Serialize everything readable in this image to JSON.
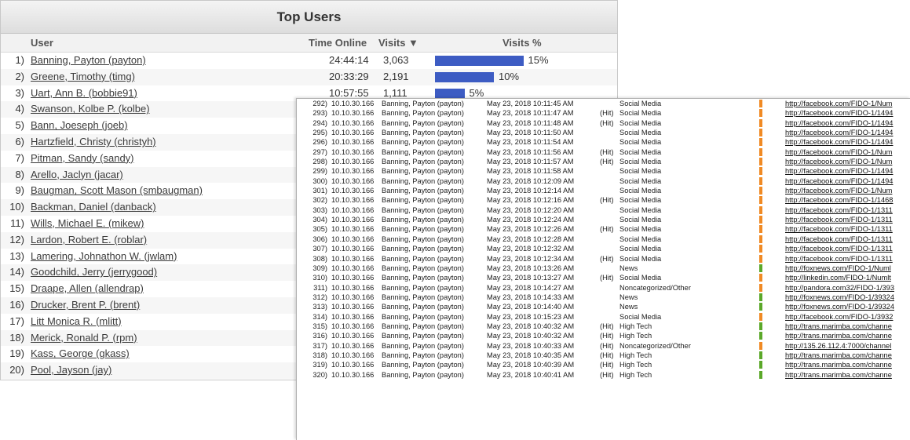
{
  "top_users": {
    "title": "Top Users",
    "columns": {
      "user": "User",
      "time_online": "Time Online",
      "visits": "Visits ▼",
      "visits_pct": "Visits %"
    },
    "bar_color": "#3d5cc3",
    "rows": [
      {
        "num": "1)",
        "user": "Banning, Payton (payton)",
        "time": "24:44:14",
        "visits": "3,063",
        "pct": "15%",
        "pct_value": 15
      },
      {
        "num": "2)",
        "user": "Greene, Timothy (timg)",
        "time": "20:33:29",
        "visits": "2,191",
        "pct": "10%",
        "pct_value": 10
      },
      {
        "num": "3)",
        "user": "Uart, Ann B. (bobbie91)",
        "time": "10:57:55",
        "visits": "1,111",
        "pct": "5%",
        "pct_value": 5
      },
      {
        "num": "4)",
        "user": "Swanson, Kolbe P. (kolbe)",
        "time": "",
        "visits": "",
        "pct": "",
        "pct_value": 0
      },
      {
        "num": "5)",
        "user": "Bann, Joeseph (joeb)",
        "time": "",
        "visits": "",
        "pct": "",
        "pct_value": 0
      },
      {
        "num": "6)",
        "user": "Hartzfield, Christy (christyh)",
        "time": "",
        "visits": "",
        "pct": "",
        "pct_value": 0
      },
      {
        "num": "7)",
        "user": "Pitman, Sandy (sandy)",
        "time": "",
        "visits": "",
        "pct": "",
        "pct_value": 0
      },
      {
        "num": "8)",
        "user": "Arello, Jaclyn (jacar)",
        "time": "",
        "visits": "",
        "pct": "",
        "pct_value": 0
      },
      {
        "num": "9)",
        "user": "Baugman, Scott Mason (smbaugman)",
        "time": "",
        "visits": "",
        "pct": "",
        "pct_value": 0
      },
      {
        "num": "10)",
        "user": "Backman, Daniel (danback)",
        "time": "",
        "visits": "",
        "pct": "",
        "pct_value": 0
      },
      {
        "num": "11)",
        "user": "Wills, Michael E. (mikew)",
        "time": "",
        "visits": "",
        "pct": "",
        "pct_value": 0
      },
      {
        "num": "12)",
        "user": "Lardon, Robert E. (roblar)",
        "time": "",
        "visits": "",
        "pct": "",
        "pct_value": 0
      },
      {
        "num": "13)",
        "user": "Lamering, Johnathon W. (jwlam)",
        "time": "",
        "visits": "",
        "pct": "",
        "pct_value": 0
      },
      {
        "num": "14)",
        "user": "Goodchild, Jerry (jerrygood)",
        "time": "",
        "visits": "",
        "pct": "",
        "pct_value": 0
      },
      {
        "num": "15)",
        "user": "Draape, Allen (allendrap)",
        "time": "",
        "visits": "",
        "pct": "",
        "pct_value": 0
      },
      {
        "num": "16)",
        "user": "Drucker, Brent P. (brent)",
        "time": "",
        "visits": "",
        "pct": "",
        "pct_value": 0
      },
      {
        "num": "17)",
        "user": "Litt Monica R. (mlitt)",
        "time": "",
        "visits": "",
        "pct": "",
        "pct_value": 0
      },
      {
        "num": "18)",
        "user": "Merick, Ronald P. (rpm)",
        "time": "",
        "visits": "",
        "pct": "",
        "pct_value": 0
      },
      {
        "num": "19)",
        "user": "Kass, George (gkass)",
        "time": "",
        "visits": "",
        "pct": "",
        "pct_value": 0
      },
      {
        "num": "20)",
        "user": "Pool, Jayson (jay)",
        "time": "",
        "visits": "",
        "pct": "",
        "pct_value": 0
      }
    ]
  },
  "activity_log": {
    "category_colors": {
      "Social Media": "#f08a24",
      "News": "#5ba829",
      "Noncategorized/Other": "#f08a24",
      "High Tech": "#5ba829"
    },
    "rows": [
      {
        "num": "292)",
        "ip": "10.10.30.166",
        "user": "Banning, Payton (payton)",
        "date": "May 23, 2018 10:11:45 AM",
        "hit": "",
        "category": "Social Media",
        "url": "http://facebook.com/FIDO-1/Num"
      },
      {
        "num": "293)",
        "ip": "10.10.30.166",
        "user": "Banning, Payton (payton)",
        "date": "May 23, 2018 10:11:47 AM",
        "hit": "(Hit)",
        "category": "Social Media",
        "url": "http://facebook.com/FIDO-1/1494"
      },
      {
        "num": "294)",
        "ip": "10.10.30.166",
        "user": "Banning, Payton (payton)",
        "date": "May 23, 2018 10:11:48 AM",
        "hit": "(Hit)",
        "category": "Social Media",
        "url": "http://facebook.com/FIDO-1/1494"
      },
      {
        "num": "295)",
        "ip": "10.10.30.166",
        "user": "Banning, Payton (payton)",
        "date": "May 23, 2018 10:11:50 AM",
        "hit": "",
        "category": "Social Media",
        "url": "http://facebook.com/FIDO-1/1494"
      },
      {
        "num": "296)",
        "ip": "10.10.30.166",
        "user": "Banning, Payton (payton)",
        "date": "May 23, 2018 10:11:54 AM",
        "hit": "",
        "category": "Social Media",
        "url": "http://facebook.com/FIDO-1/1494"
      },
      {
        "num": "297)",
        "ip": "10.10.30.166",
        "user": "Banning, Payton (payton)",
        "date": "May 23, 2018 10:11:56 AM",
        "hit": "(Hit)",
        "category": "Social Media",
        "url": "http://facebook.com/FIDO-1/Num"
      },
      {
        "num": "298)",
        "ip": "10.10.30.166",
        "user": "Banning, Payton (payton)",
        "date": "May 23, 2018 10:11:57 AM",
        "hit": "(Hit)",
        "category": "Social Media",
        "url": "http://facebook.com/FIDO-1/Num"
      },
      {
        "num": "299)",
        "ip": "10.10.30.166",
        "user": "Banning, Payton (payton)",
        "date": "May 23, 2018 10:11:58 AM",
        "hit": "",
        "category": "Social Media",
        "url": "http://facebook.com/FIDO-1/1494"
      },
      {
        "num": "300)",
        "ip": "10.10.30.166",
        "user": "Banning, Payton (payton)",
        "date": "May 23, 2018 10:12:09 AM",
        "hit": "",
        "category": "Social Media",
        "url": "http://facebook.com/FIDO-1/1494"
      },
      {
        "num": "301)",
        "ip": "10.10.30.166",
        "user": "Banning, Payton (payton)",
        "date": "May 23, 2018 10:12:14 AM",
        "hit": "",
        "category": "Social Media",
        "url": "http://facebook.com/FIDO-1/Num"
      },
      {
        "num": "302)",
        "ip": "10.10.30.166",
        "user": "Banning, Payton (payton)",
        "date": "May 23, 2018 10:12:16 AM",
        "hit": "(Hit)",
        "category": "Social Media",
        "url": "http://facebook.com/FIDO-1/1468"
      },
      {
        "num": "303)",
        "ip": "10.10.30.166",
        "user": "Banning, Payton (payton)",
        "date": "May 23, 2018 10:12:20 AM",
        "hit": "",
        "category": "Social Media",
        "url": "http://facebook.com/FIDO-1/1311"
      },
      {
        "num": "304)",
        "ip": "10.10.30.166",
        "user": "Banning, Payton (payton)",
        "date": "May 23, 2018 10:12:24 AM",
        "hit": "",
        "category": "Social Media",
        "url": "http://facebook.com/FIDO-1/1311"
      },
      {
        "num": "305)",
        "ip": "10.10.30.166",
        "user": "Banning, Payton (payton)",
        "date": "May 23, 2018 10:12:26 AM",
        "hit": "(Hit)",
        "category": "Social Media",
        "url": "http://facebook.com/FIDO-1/1311"
      },
      {
        "num": "306)",
        "ip": "10.10.30.166",
        "user": "Banning, Payton (payton)",
        "date": "May 23, 2018 10:12:28 AM",
        "hit": "",
        "category": "Social Media",
        "url": "http://facebook.com/FIDO-1/1311"
      },
      {
        "num": "307)",
        "ip": "10.10.30.166",
        "user": "Banning, Payton (payton)",
        "date": "May 23, 2018 10:12:32 AM",
        "hit": "",
        "category": "Social Media",
        "url": "http://facebook.com/FIDO-1/1311"
      },
      {
        "num": "308)",
        "ip": "10.10.30.166",
        "user": "Banning, Payton (payton)",
        "date": "May 23, 2018 10:12:34 AM",
        "hit": "(Hit)",
        "category": "Social Media",
        "url": "http://facebook.com/FIDO-1/1311"
      },
      {
        "num": "309)",
        "ip": "10.10.30.166",
        "user": "Banning, Payton (payton)",
        "date": "May 23, 2018 10:13:26 AM",
        "hit": "",
        "category": "News",
        "url": "http://foxnews.com/FIDO-1/Numl"
      },
      {
        "num": "310)",
        "ip": "10.10.30.166",
        "user": "Banning, Payton (payton)",
        "date": "May 23, 2018 10:13:27 AM",
        "hit": "(Hit)",
        "category": "Social Media",
        "url": "http://linkedin.com/FIDO-1/Numlt"
      },
      {
        "num": "311)",
        "ip": "10.10.30.166",
        "user": "Banning, Payton (payton)",
        "date": "May 23, 2018 10:14:27 AM",
        "hit": "",
        "category": "Noncategorized/Other",
        "url": "http://pandora.com32/FIDO-1/393"
      },
      {
        "num": "312)",
        "ip": "10.10.30.166",
        "user": "Banning, Payton (payton)",
        "date": "May 23, 2018 10:14:33 AM",
        "hit": "",
        "category": "News",
        "url": "http://foxnews.com/FIDO-1/39324"
      },
      {
        "num": "313)",
        "ip": "10.10.30.166",
        "user": "Banning, Payton (payton)",
        "date": "May 23, 2018 10:14:40 AM",
        "hit": "",
        "category": "News",
        "url": "http://foxnews.com/FIDO-1/39324"
      },
      {
        "num": "314)",
        "ip": "10.10.30.166",
        "user": "Banning, Payton (payton)",
        "date": "May 23, 2018 10:15:23 AM",
        "hit": "",
        "category": "Social Media",
        "url": "http://facebook.com/FIDO-1/3932"
      },
      {
        "num": "315)",
        "ip": "10.10.30.166",
        "user": "Banning, Payton (payton)",
        "date": "May 23, 2018 10:40:32 AM",
        "hit": "(Hit)",
        "category": "High Tech",
        "url": "http://trans.marimba.com/channe"
      },
      {
        "num": "316)",
        "ip": "10.10.30.166",
        "user": "Banning, Payton (payton)",
        "date": "May 23, 2018 10:40:32 AM",
        "hit": "(Hit)",
        "category": "High Tech",
        "url": "http://trans.marimba.com/channe"
      },
      {
        "num": "317)",
        "ip": "10.10.30.166",
        "user": "Banning, Payton (payton)",
        "date": "May 23, 2018 10:40:33 AM",
        "hit": "(Hit)",
        "category": "Noncategorized/Other",
        "url": "http://135.26.112.4:7000/channel"
      },
      {
        "num": "318)",
        "ip": "10.10.30.166",
        "user": "Banning, Payton (payton)",
        "date": "May 23, 2018 10:40:35 AM",
        "hit": "(Hit)",
        "category": "High Tech",
        "url": "http://trans.marimba.com/channe"
      },
      {
        "num": "319)",
        "ip": "10.10.30.166",
        "user": "Banning, Payton (payton)",
        "date": "May 23, 2018 10:40:39 AM",
        "hit": "(Hit)",
        "category": "High Tech",
        "url": "http://trans.marimba.com/channe"
      },
      {
        "num": "320)",
        "ip": "10.10.30.166",
        "user": "Banning, Payton (payton)",
        "date": "May 23, 2018 10:40:41 AM",
        "hit": "(Hit)",
        "category": "High Tech",
        "url": "http://trans.marimba.com/channe"
      }
    ]
  }
}
